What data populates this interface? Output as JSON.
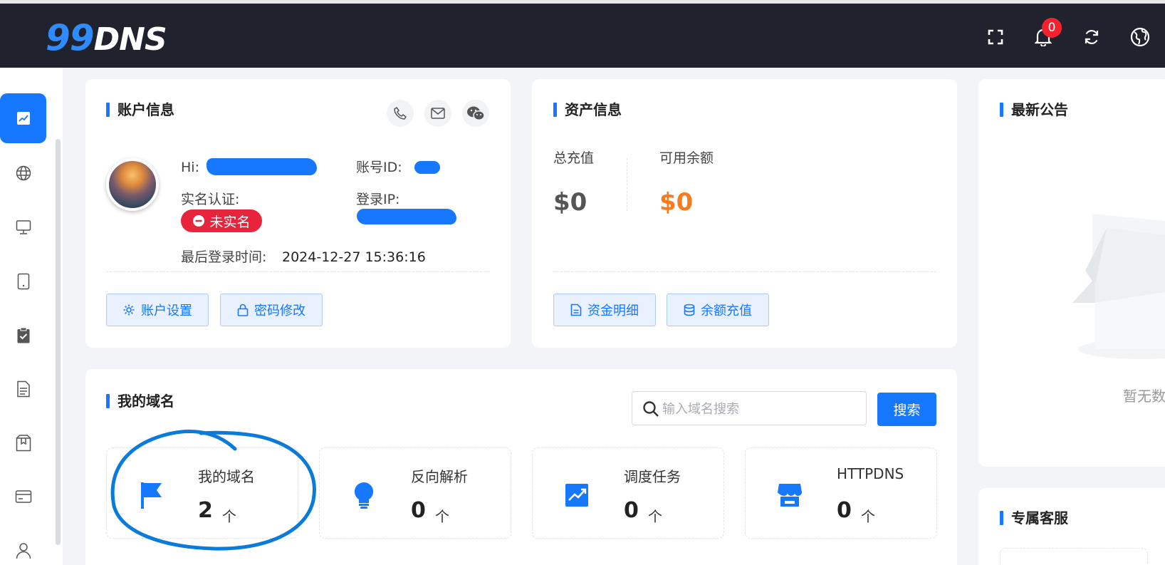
{
  "header": {
    "logo_num": "99",
    "logo_text": "DNS",
    "notification_count": "0",
    "icons": [
      "fullscreen-icon",
      "bell-icon",
      "refresh-icon",
      "globe-icon"
    ]
  },
  "sidebar": {
    "items": [
      "dashboard-chart-icon",
      "globe-icon",
      "monitor-icon",
      "tablet-icon",
      "clipboard-check-icon",
      "document-icon",
      "package-icon",
      "credit-card-icon",
      "user-icon"
    ]
  },
  "account": {
    "title": "账户信息",
    "hi_label": "Hi:",
    "id_label": "账号ID:",
    "realname_label": "实名认证:",
    "realname_status": "未实名",
    "ip_label": "登录IP:",
    "last_login_label": "最后登录时间:",
    "last_login_value": "2024-12-27 15:36:16",
    "settings_button": "账户设置",
    "password_button": "密码修改"
  },
  "assets": {
    "title": "资产信息",
    "total_label": "总充值",
    "total_value": "$0",
    "available_label": "可用余额",
    "available_value": "$0",
    "detail_button": "资金明细",
    "recharge_button": "余额充值"
  },
  "notice": {
    "title": "最新公告",
    "empty_text": "暂无数"
  },
  "domains": {
    "title": "我的域名",
    "search_placeholder": "输入域名搜索",
    "search_button": "搜索",
    "stats": [
      {
        "label": "我的域名",
        "value": "2",
        "unit": "个"
      },
      {
        "label": "反向解析",
        "value": "0",
        "unit": "个"
      },
      {
        "label": "调度任务",
        "value": "0",
        "unit": "个"
      },
      {
        "label": "HTTPDNS",
        "value": "0",
        "unit": "个"
      }
    ]
  },
  "service": {
    "title": "专属客服"
  },
  "colors": {
    "accent": "#1677ff",
    "header_bg": "#20222e",
    "danger": "#e8243c",
    "orange": "#f77b21"
  }
}
